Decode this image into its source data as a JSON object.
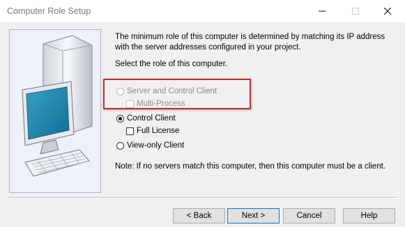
{
  "window": {
    "title": "Computer Role Setup"
  },
  "description": {
    "line1": "The minimum role of this computer is determined by matching its IP address",
    "line2": "with the server addresses configured in your project.",
    "prompt": "Select the role of this computer."
  },
  "options": {
    "server_and_control_client": {
      "label": "Server and Control Client",
      "selected": false,
      "enabled": false
    },
    "multi_process": {
      "label": "Multi-Process",
      "checked": false,
      "enabled": false
    },
    "control_client": {
      "label": "Control Client",
      "selected": true,
      "enabled": true
    },
    "full_license": {
      "label": "Full License",
      "checked": false,
      "enabled": true
    },
    "view_only_client": {
      "label": "View-only Client",
      "selected": false,
      "enabled": true
    }
  },
  "note": "Note: If no servers match this computer, then this computer must be a client.",
  "buttons": {
    "back": "< Back",
    "next": "Next >",
    "cancel": "Cancel",
    "help": "Help"
  },
  "annotation": {
    "highlight_color": "#cc2a2a"
  }
}
